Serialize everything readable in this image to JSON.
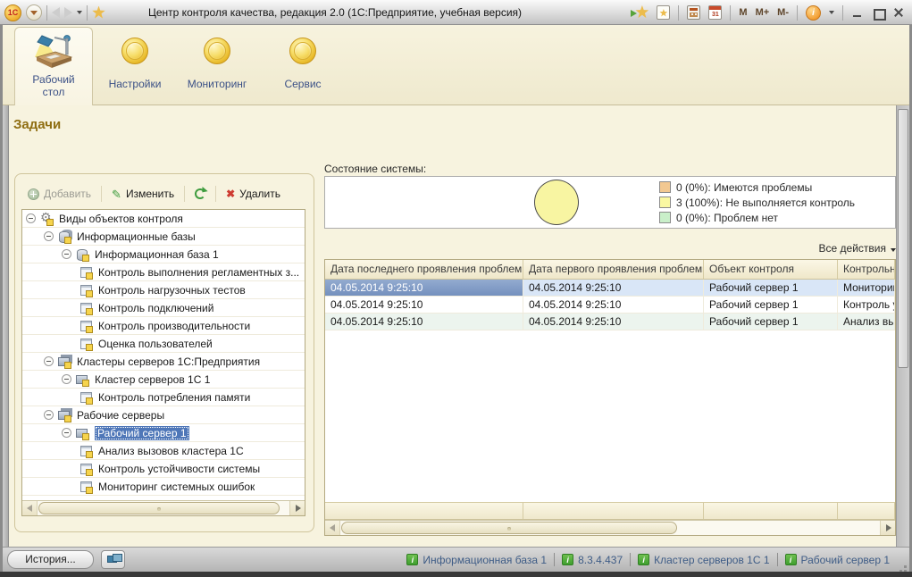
{
  "window": {
    "title": "Центр контроля качества, редакция 2.0 (1С:Предприятие, учебная версия)"
  },
  "titlebar": {
    "logo": "1С",
    "calendar_day": "31",
    "memory": [
      "M",
      "M+",
      "M-"
    ],
    "info_glyph": "i"
  },
  "tabs": [
    {
      "label": "Рабочий стол"
    },
    {
      "label": "Настройки"
    },
    {
      "label": "Мониторинг"
    },
    {
      "label": "Сервис"
    }
  ],
  "page": {
    "title": "Задачи"
  },
  "tree_panel": {
    "toolbar": {
      "add": "Добавить",
      "edit": "Изменить",
      "delete": "Удалить"
    },
    "items": [
      {
        "label": "Виды объектов контроля",
        "level": 0,
        "icon": "gear",
        "selected": false
      },
      {
        "label": "Информационные базы",
        "level": 1,
        "icon": "databases",
        "selected": false
      },
      {
        "label": "Информационная база 1",
        "level": 2,
        "icon": "database",
        "selected": false
      },
      {
        "label": "Контроль выполнения регламентных з...",
        "level": 3,
        "icon": "task",
        "selected": false
      },
      {
        "label": "Контроль нагрузочных тестов",
        "level": 3,
        "icon": "task",
        "selected": false
      },
      {
        "label": "Контроль подключений",
        "level": 3,
        "icon": "task",
        "selected": false
      },
      {
        "label": "Контроль производительности",
        "level": 3,
        "icon": "task",
        "selected": false
      },
      {
        "label": "Оценка пользователей",
        "level": 3,
        "icon": "task",
        "selected": false
      },
      {
        "label": "Кластеры серверов 1С:Предприятия",
        "level": 1,
        "icon": "servers",
        "selected": false
      },
      {
        "label": "Кластер серверов 1С 1",
        "level": 2,
        "icon": "server",
        "selected": false
      },
      {
        "label": "Контроль потребления памяти",
        "level": 3,
        "icon": "task",
        "selected": false
      },
      {
        "label": "Рабочие серверы",
        "level": 1,
        "icon": "servers",
        "selected": false
      },
      {
        "label": "Рабочий сервер 1",
        "level": 2,
        "icon": "server",
        "selected": true
      },
      {
        "label": "Анализ вызовов кластера 1С",
        "level": 3,
        "icon": "task",
        "selected": false
      },
      {
        "label": "Контроль устойчивости системы",
        "level": 3,
        "icon": "task",
        "selected": false
      },
      {
        "label": "Мониторинг системных ошибок",
        "level": 3,
        "icon": "task",
        "selected": false
      }
    ]
  },
  "status_panel": {
    "label": "Состояние системы:",
    "legend": [
      {
        "text": "0 (0%): Имеются проблемы",
        "color": "#F2C891"
      },
      {
        "text": "3 (100%): Не выполняется контроль",
        "color": "#FAF8A2"
      },
      {
        "text": "0 (0%): Проблем нет",
        "color": "#C9EFC9"
      }
    ],
    "all_actions_label": "Все действия"
  },
  "chart_data": {
    "type": "pie",
    "title": "Состояние системы:",
    "slices": [
      {
        "label": "Имеются проблемы",
        "count": 0,
        "percent": 0,
        "color": "#F2C891"
      },
      {
        "label": "Не выполняется контроль",
        "count": 3,
        "percent": 100,
        "color": "#FAF8A2"
      },
      {
        "label": "Проблем нет",
        "count": 0,
        "percent": 0,
        "color": "#C9EFC9"
      }
    ],
    "legend_position": "right"
  },
  "table": {
    "columns": [
      "Дата последнего проявления проблемы",
      "Дата первого проявления проблемы",
      "Объект контроля",
      "Контрольн"
    ],
    "rows": [
      [
        "04.05.2014 9:25:10",
        "04.05.2014 9:25:10",
        "Рабочий сервер 1",
        "Мониторин"
      ],
      [
        "04.05.2014 9:25:10",
        "04.05.2014 9:25:10",
        "Рабочий сервер 1",
        "Контроль у"
      ],
      [
        "04.05.2014 9:25:10",
        "04.05.2014 9:25:10",
        "Рабочий сервер 1",
        "Анализ вы"
      ]
    ],
    "selected_row": 0
  },
  "statusbar": {
    "history_label": "История...",
    "info_glyph": "i",
    "links": [
      {
        "label": "Информационная база 1"
      },
      {
        "label": "8.3.4.437"
      },
      {
        "label": "Кластер серверов 1С 1"
      },
      {
        "label": "Рабочий сервер 1"
      }
    ]
  },
  "colors": {
    "selection_blue": "#4F77B8",
    "row_selected_bg": "#D9E6F7",
    "legend_orange": "#F2C891",
    "legend_yellow": "#FAF8A2",
    "legend_green": "#C9EFC9",
    "pie_fill": "#F8F5A2",
    "content_bg": "#F7F3DF",
    "tab_label_blue": "#3A5086",
    "page_title_brown": "#8F6E12",
    "status_link_blue": "#3E5C86",
    "info_icon_green": "#3F9E2F"
  }
}
